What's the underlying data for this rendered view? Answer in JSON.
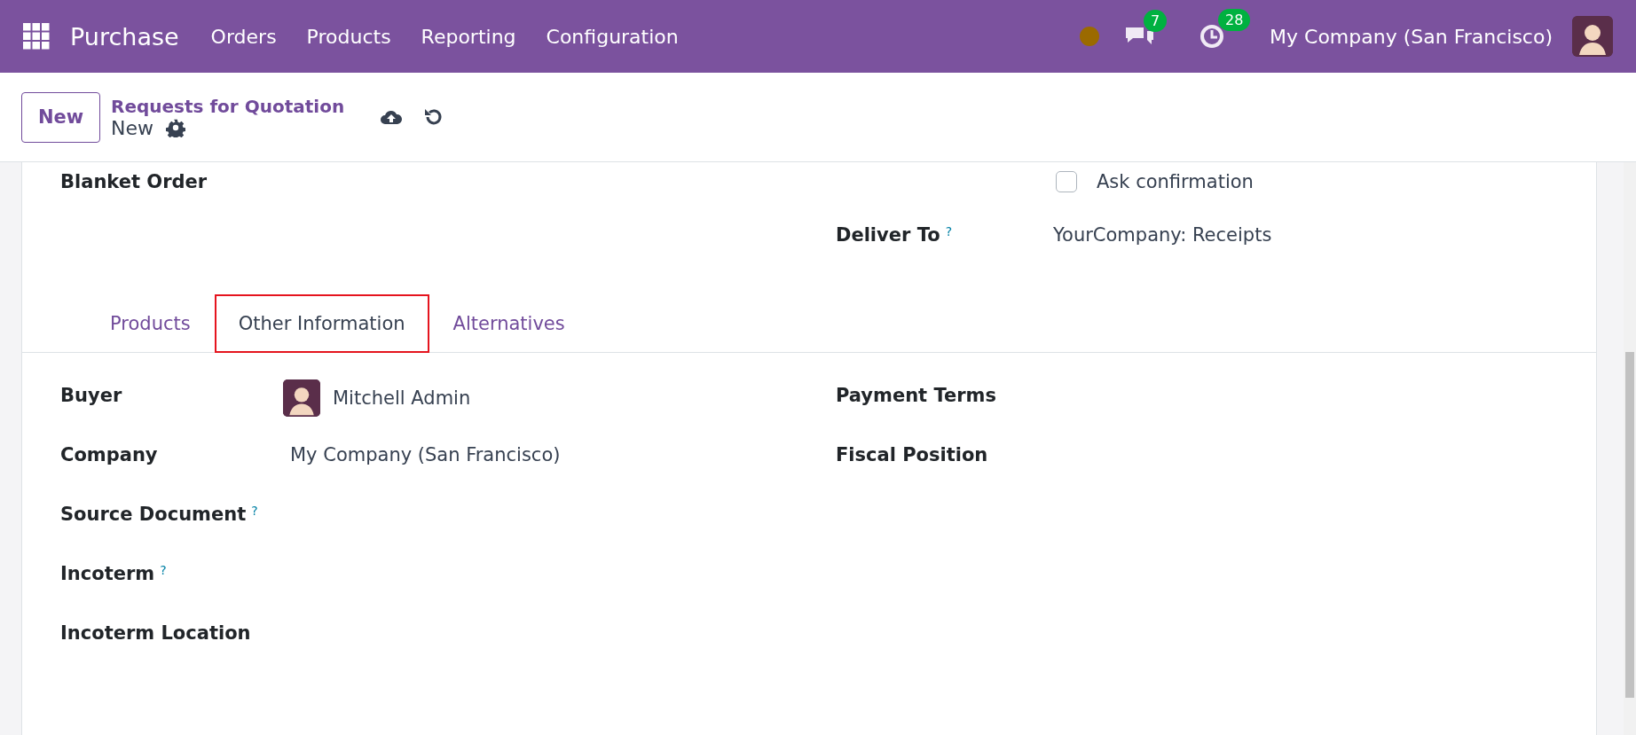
{
  "navbar": {
    "app_name": "Purchase",
    "menu": [
      "Orders",
      "Products",
      "Reporting",
      "Configuration"
    ],
    "messages_count": "7",
    "activities_count": "28",
    "company": "My Company (San Francisco)"
  },
  "control_panel": {
    "new_button": "New",
    "breadcrumb": "Requests for Quotation",
    "record": "New"
  },
  "header_fields": {
    "left": [
      {
        "label": "Blanket Order"
      }
    ],
    "checkbox": {
      "label": "Ask confirmation",
      "checked": false
    },
    "right": [
      {
        "label": "Deliver To",
        "help": "?",
        "value": "YourCompany: Receipts"
      }
    ]
  },
  "tabs": [
    {
      "label": "Products",
      "selected": false
    },
    {
      "label": "Other Information",
      "selected": true
    },
    {
      "label": "Alternatives",
      "selected": false
    }
  ],
  "fields_left": [
    {
      "label": "Buyer",
      "value": "Mitchell Admin",
      "kind": "user"
    },
    {
      "label": "Company",
      "value": "My Company (San Francisco)",
      "kind": "text"
    },
    {
      "label": "Source Document",
      "help": "?"
    },
    {
      "label": "Incoterm",
      "help": "?"
    },
    {
      "label": "Incoterm Location"
    }
  ],
  "fields_right": [
    {
      "label": "Payment Terms"
    },
    {
      "label": "Fiscal Position"
    }
  ]
}
